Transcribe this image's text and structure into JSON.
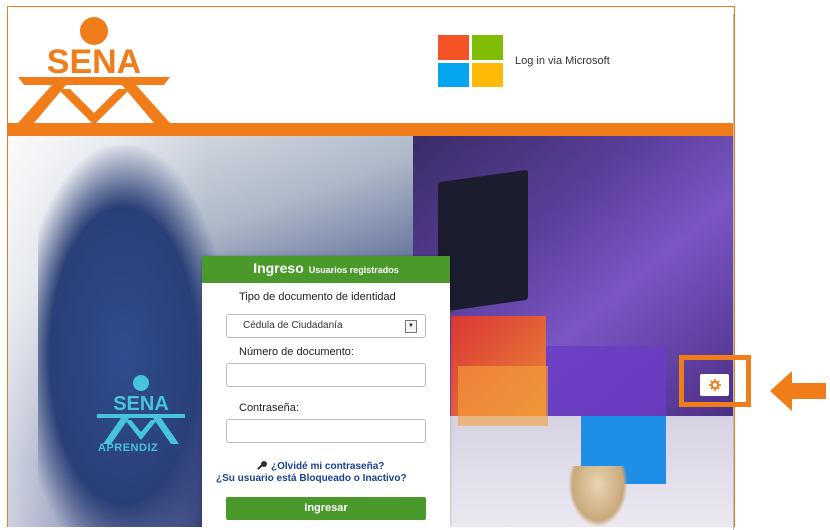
{
  "header": {
    "logo_text": "SENA",
    "microsoft_login": {
      "label": "Log in via Microsoft",
      "colors": [
        "#f35325",
        "#81bc06",
        "#05a6f0",
        "#ffba08"
      ]
    }
  },
  "hero": {
    "shirt_logo_text": "SENA",
    "shirt_caption": "APRENDIZ"
  },
  "login_card": {
    "title": "Ingreso",
    "subtitle": "Usuarios registrados",
    "doc_type_label": "Tipo de documento de identidad",
    "doc_type_selected": "Cédula de Ciudadanía",
    "doc_number_label": "Número de documento:",
    "doc_number_value": "",
    "password_label": "Contraseña:",
    "password_value": "",
    "forgot_link": "¿Olvidé mi contraseña?",
    "forgot_icon": "key-icon",
    "blocked_link": "¿Su usuario está Bloqueado o Inactivo?",
    "submit_label": "Ingresar"
  },
  "settings": {
    "icon": "gear-icon"
  },
  "colors": {
    "orange": "#f07c1a",
    "green": "#4a9a2b",
    "link": "#1a3f8f"
  }
}
